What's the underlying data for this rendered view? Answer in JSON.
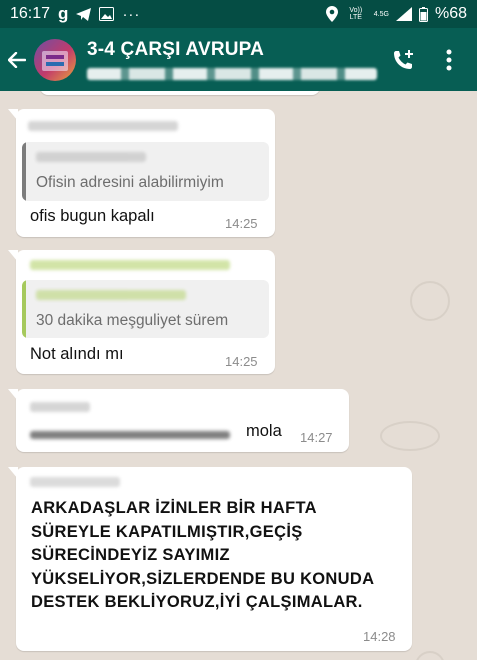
{
  "status_bar": {
    "time": "16:17",
    "network_label": "Vo)) LTE",
    "network_speed": "4.5G",
    "battery": "%68",
    "icons": [
      "g-icon",
      "telegram-icon",
      "gallery-icon",
      "more-dots-icon",
      "location-icon",
      "signal-icon",
      "battery-icon"
    ]
  },
  "header": {
    "title": "3-4 ÇARŞI AVRUPA",
    "icons": [
      "back-arrow-icon",
      "group-avatar",
      "add-call-icon",
      "overflow-menu-icon"
    ]
  },
  "messages": [
    {
      "quoted_text": "Ofisin adresini alabilirmiyim",
      "text": "ofis bugun kapalı",
      "time": "14:25"
    },
    {
      "quoted_text": "30 dakika meşguliyet sürem",
      "text": "Not alındı mı",
      "time": "14:25"
    },
    {
      "text": "mola",
      "time": "14:27"
    },
    {
      "text": "ARKADAŞLAR İZİNLER BİR HAFTA\nSÜREYLE KAPATILMIŞTIR,GEÇİŞ\nSÜRECİNDEYİZ SAYIMIZ\nYÜKSELİYOR,SİZLERDENDE BU KONUDA\nDESTEK BEKLİYORUZ,İYİ ÇALŞIMALAR.",
      "time": "14:28"
    }
  ],
  "colors": {
    "header": "#075e54",
    "status_bar": "#054d44",
    "chat_background": "#e5ddd5",
    "bubble": "#ffffff",
    "quote_bar_1": "#7c7c7c",
    "quote_bar_2": "#a6c95c",
    "sender_green": "#b5d36e"
  }
}
